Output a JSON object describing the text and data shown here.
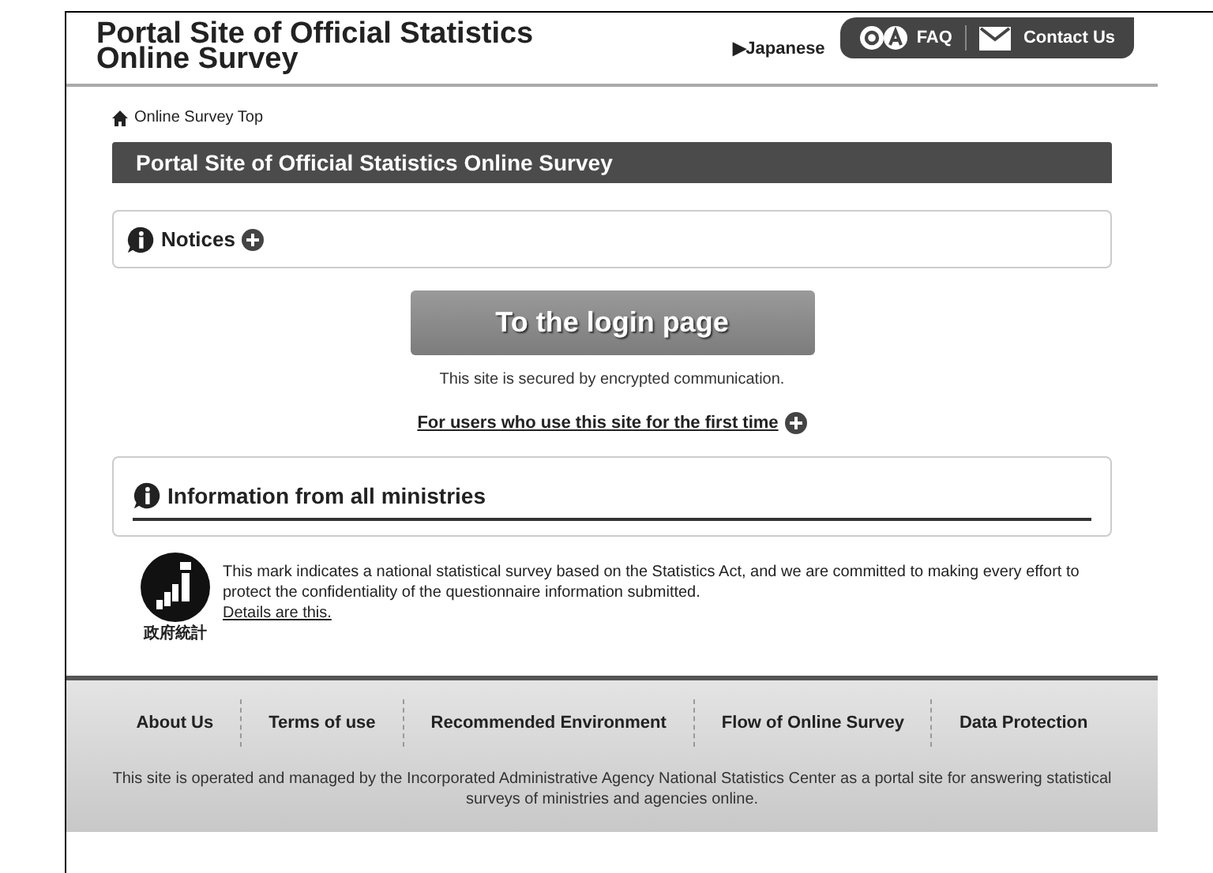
{
  "header": {
    "title_line1": "Portal Site of Official Statistics",
    "title_line2": "Online Survey",
    "language_link": "▶Japanese",
    "faq": "FAQ",
    "contact": "Contact Us"
  },
  "breadcrumb": "Online Survey Top",
  "page_title": "Portal Site of Official Statistics Online Survey",
  "notices": {
    "title": "Notices",
    "expanded": false
  },
  "login_button": "To the login page",
  "secure_note": "This site is secured by encrypted communication.",
  "first_time_link": "For users who use this site for the first time",
  "ministries": {
    "title": "Information from all ministries"
  },
  "mark": {
    "caption": "政府統計",
    "text": "This mark indicates a national statistical survey based on the Statistics Act, and we are committed to making every effort to protect the confidentiality of the questionnaire information submitted.",
    "link": "Details are this."
  },
  "footer": {
    "links": [
      "About Us",
      "Terms of use",
      "Recommended Environment",
      "Flow of Online Survey",
      "Data Protection"
    ],
    "note": "This site is operated and managed by the Incorporated Administrative Agency National Statistics Center as a portal site for answering statistical surveys of ministries and agencies online."
  }
}
